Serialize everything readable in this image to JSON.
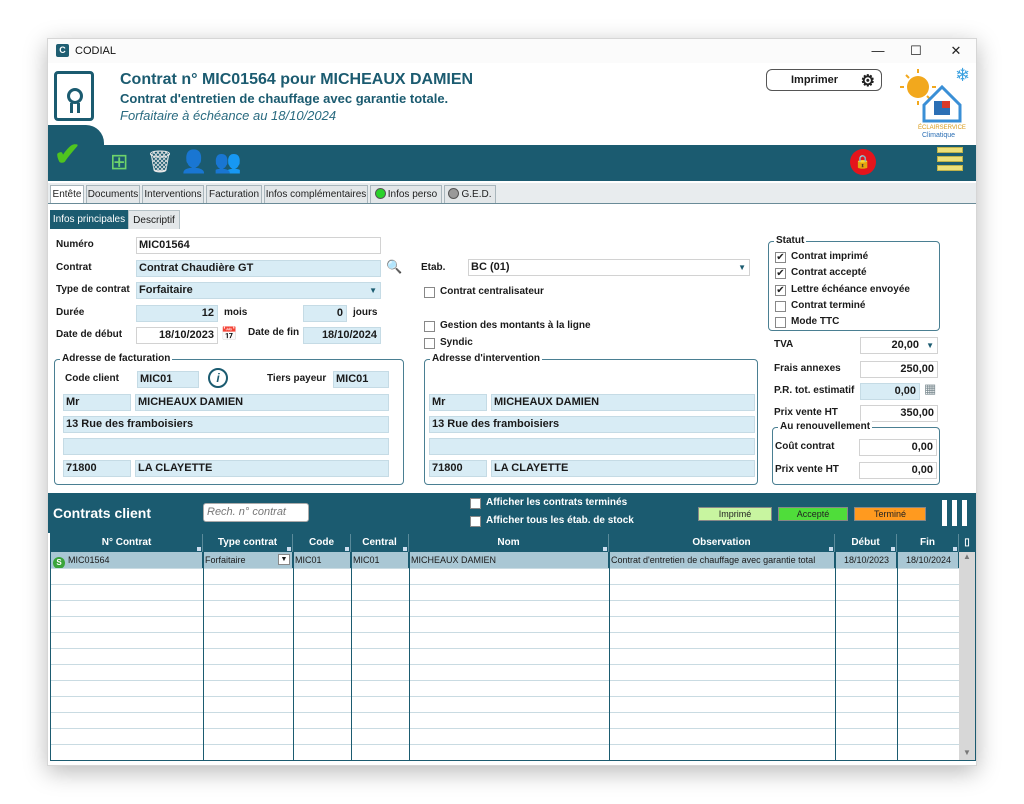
{
  "window": {
    "title": "CODIAL",
    "minimize": "—",
    "maximize": "☐",
    "close": "✕"
  },
  "header": {
    "title": "Contrat n° MIC01564  pour  MICHEAUX DAMIEN",
    "subtitle": "Contrat d'entretien de chauffage avec garantie totale.",
    "italic": "Forfaitaire à échéance au 18/10/2024",
    "print_label": "Imprimer",
    "logo_text_1": "ÉCLAIRSERVICE",
    "logo_text_2": "Climatique"
  },
  "tabs": [
    "Entête",
    "Documents",
    "Interventions",
    "Facturation",
    "Infos complémentaires",
    "Infos perso",
    "G.E.D."
  ],
  "subtabs": [
    "Infos principales",
    "Descriptif"
  ],
  "form": {
    "numero_label": "Numéro",
    "numero": "MIC01564",
    "contrat_label": "Contrat",
    "contrat": "Contrat Chaudière GT",
    "type_label": "Type de contrat",
    "type": "Forfaitaire",
    "duree_label": "Durée",
    "duree_mois": "12",
    "mois_label": "mois",
    "duree_jours": "0",
    "jours_label": "jours",
    "debut_label": "Date de début",
    "debut": "18/10/2023",
    "fin_label": "Date de fin",
    "fin": "18/10/2024",
    "etab_label": "Etab.",
    "etab": "BC (01)",
    "centralisateur_label": "Contrat centralisateur",
    "gestion_label": "Gestion des montants à la ligne",
    "syndic_label": "Syndic"
  },
  "facturation": {
    "title": "Adresse de facturation",
    "code_client_label": "Code client",
    "code_client": "MIC01",
    "tiers_label": "Tiers payeur",
    "tiers": "MIC01",
    "civilite": "Mr",
    "nom": "MICHEAUX DAMIEN",
    "adresse": "13 Rue des framboisiers",
    "adresse2": "",
    "cp": "71800",
    "ville": "LA CLAYETTE"
  },
  "intervention": {
    "title": "Adresse d'intervention",
    "civilite": "Mr",
    "nom": "MICHEAUX DAMIEN",
    "adresse": "13 Rue des framboisiers",
    "adresse2": "",
    "cp": "71800",
    "ville": "LA CLAYETTE"
  },
  "statut": {
    "title": "Statut",
    "items": [
      {
        "label": "Contrat imprimé",
        "checked": "✔"
      },
      {
        "label": "Contrat accepté",
        "checked": "✔"
      },
      {
        "label": "Lettre échéance envoyée",
        "checked": "✔"
      },
      {
        "label": "Contrat terminé",
        "checked": ""
      },
      {
        "label": "Mode TTC",
        "checked": ""
      }
    ]
  },
  "montants": {
    "tva_label": "TVA",
    "tva": "20,00",
    "frais_label": "Frais annexes",
    "frais": "250,00",
    "pr_label": "P.R. tot. estimatif",
    "pr": "0,00",
    "prix_label": "Prix vente HT",
    "prix": "350,00"
  },
  "renouvellement": {
    "title": "Au renouvellement",
    "cout_label": "Coût contrat",
    "cout": "0,00",
    "prix_label": "Prix vente HT",
    "prix": "0,00"
  },
  "list": {
    "title": "Contrats client",
    "search_placeholder": "Rech. n° contrat",
    "show_terminated": "Afficher les contrats terminés",
    "show_all_etab": "Afficher tous les étab. de stock",
    "legend": [
      {
        "label": "Imprimé",
        "color": "#c8f5a0"
      },
      {
        "label": "Accepté",
        "color": "#4fdd3a"
      },
      {
        "label": "Terminé",
        "color": "#ff9a1f"
      }
    ],
    "columns": [
      "N° Contrat",
      "Type contrat",
      "Code",
      "Central",
      "Nom",
      "Observation",
      "Début",
      "Fin"
    ],
    "rows": [
      {
        "num": "MIC01564",
        "type": "Forfaitaire",
        "code": "MIC01",
        "central": "MIC01",
        "nom": "MICHEAUX DAMIEN",
        "obs": "Contrat d'entretien de chauffage avec garantie total",
        "debut": "18/10/2023",
        "fin": "18/10/2024"
      }
    ]
  },
  "colors": {
    "primary": "#1b5b70",
    "field": "#d8ecf5",
    "check": "#4fc41f",
    "lock": "#e4141c"
  }
}
